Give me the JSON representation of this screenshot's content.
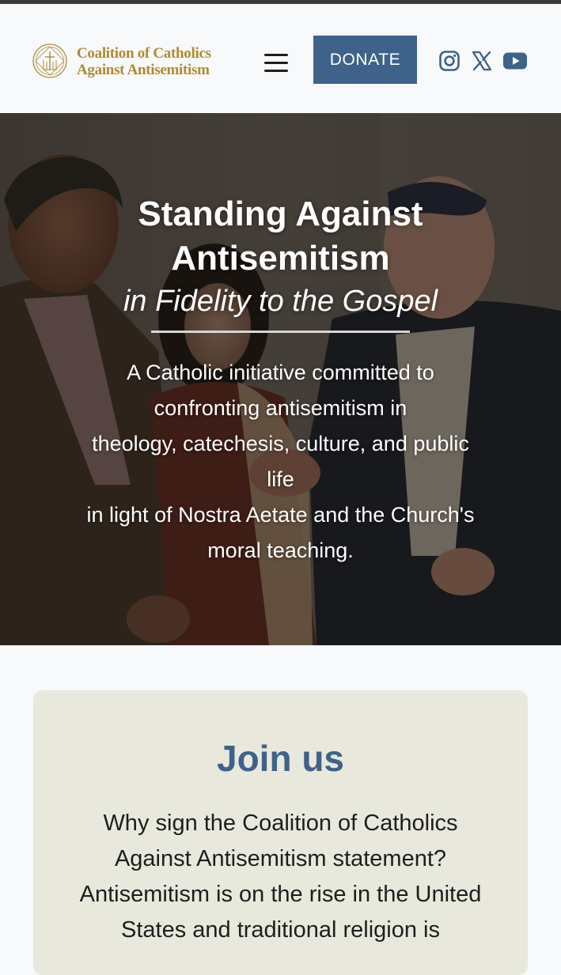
{
  "header": {
    "logo_line1": "Coalition of Catholics",
    "logo_line2": "Against Antisemitism",
    "menu_icon": "hamburger-menu-icon",
    "donate_label": "DONATE",
    "social": [
      "instagram-icon",
      "x-icon",
      "youtube-icon"
    ]
  },
  "hero": {
    "title": "Standing Against Antisemitism",
    "subtitle": "in Fidelity to the Gospel",
    "description_lines": [
      "A Catholic initiative committed to",
      "confronting antisemitism in",
      "theology, catechesis, culture, and public",
      "life",
      "in light of Nostra Aetate and the Church's",
      "moral teaching."
    ]
  },
  "join": {
    "title": "Join us",
    "text_lines": [
      "Why sign the Coalition of Catholics",
      "Against Antisemitism statement?",
      "Antisemitism is on the rise in the United",
      "States and traditional religion is"
    ]
  },
  "colors": {
    "brand_gold": "#b08a2e",
    "brand_blue": "#3e6289",
    "card_bg": "#e9e8dd"
  }
}
